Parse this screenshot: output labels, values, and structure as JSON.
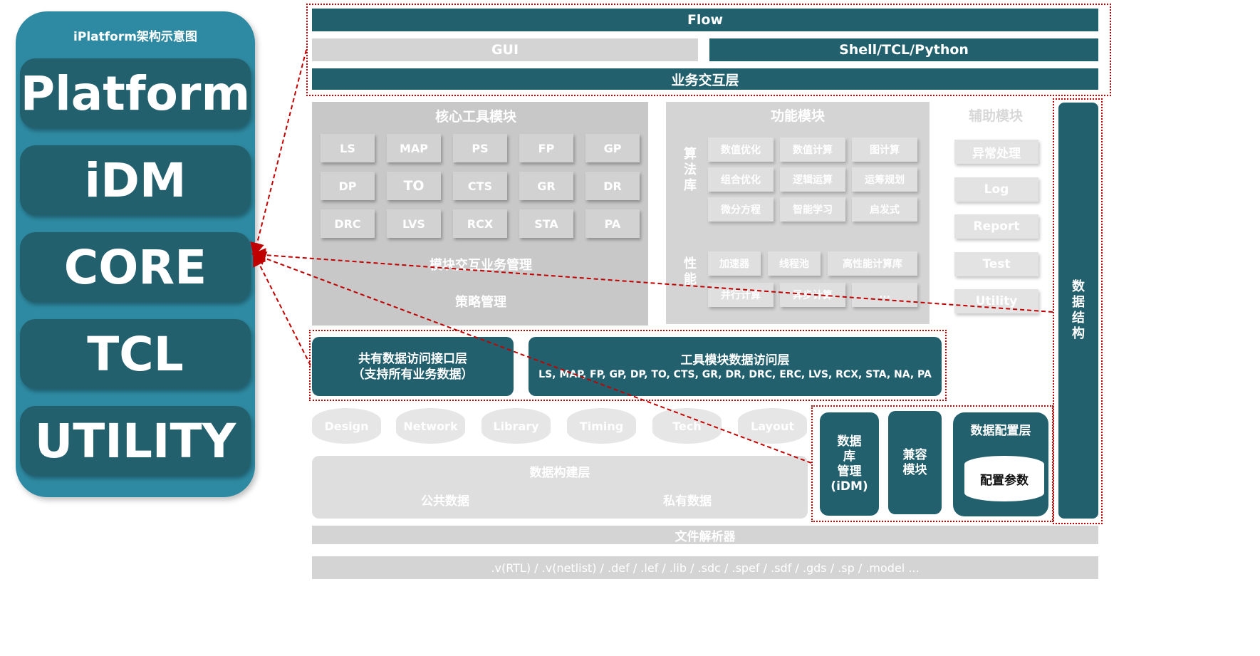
{
  "left": {
    "title": "iPlatform架构示意图",
    "layers": [
      "Platform",
      "iDM",
      "CORE",
      "TCL",
      "UTILITY"
    ]
  },
  "top": {
    "flow": "Flow",
    "gui": "GUI",
    "shell": "Shell/TCL/Python",
    "business": "业务交互层"
  },
  "core_tools": {
    "title": "核心工具模块",
    "tiles": [
      "LS",
      "MAP",
      "PS",
      "FP",
      "GP",
      "DP",
      "TO",
      "CTS",
      "GR",
      "DR",
      "DRC",
      "LVS",
      "RCX",
      "STA",
      "PA"
    ],
    "interaction": "模块交互业务管理",
    "strategy": "策略管理"
  },
  "function": {
    "title": "功能模块",
    "algo_label": "算\n法\n库",
    "algo_tiles": [
      "数值优化",
      "数值计算",
      "图计算",
      "组合优化",
      "逻辑运算",
      "运筹规划",
      "微分方程",
      "智能学习",
      "启发式"
    ],
    "perf_label": "性\n能",
    "perf_row1": [
      "加速器",
      "线程池",
      "高性能计算库"
    ],
    "perf_row2": [
      "并行计算",
      "异步计算",
      "..."
    ]
  },
  "aux": {
    "title": "辅助模块",
    "items": [
      "异常处理",
      "Log",
      "Report",
      "Test",
      "Utility"
    ]
  },
  "data_structure": "数\n据\n结\n构",
  "access": {
    "shared": "共有数据访问接口层\n（支持所有业务数据）",
    "tool_title": "工具模块数据访问层",
    "tool_list": "LS, MAP, FP, GP, DP, TO, CTS, GR, DR, DRC, ERC, LVS, RCX, STA, NA, PA"
  },
  "databases": [
    "Design",
    "Network",
    "Library",
    "Timing",
    "Tech",
    "Layout"
  ],
  "build": {
    "title": "数据构建层",
    "public": "公共数据",
    "private": "私有数据"
  },
  "idm": {
    "db_mgmt": "数据\n库\n管理\n(iDM)",
    "compat": "兼容\n模块",
    "config_title": "数据配置层",
    "config_params": "配置参数"
  },
  "parser": "文件解析器",
  "formats": ".v(RTL) / .v(netlist) / .def / .lef / .lib / .sdc / .spef / .sdf / .gds / .sp / .model ...",
  "colors": {
    "dark": "#23606e",
    "panel": "#2e8aa2",
    "light": "#d4d4d4",
    "dash": "#c00000"
  }
}
